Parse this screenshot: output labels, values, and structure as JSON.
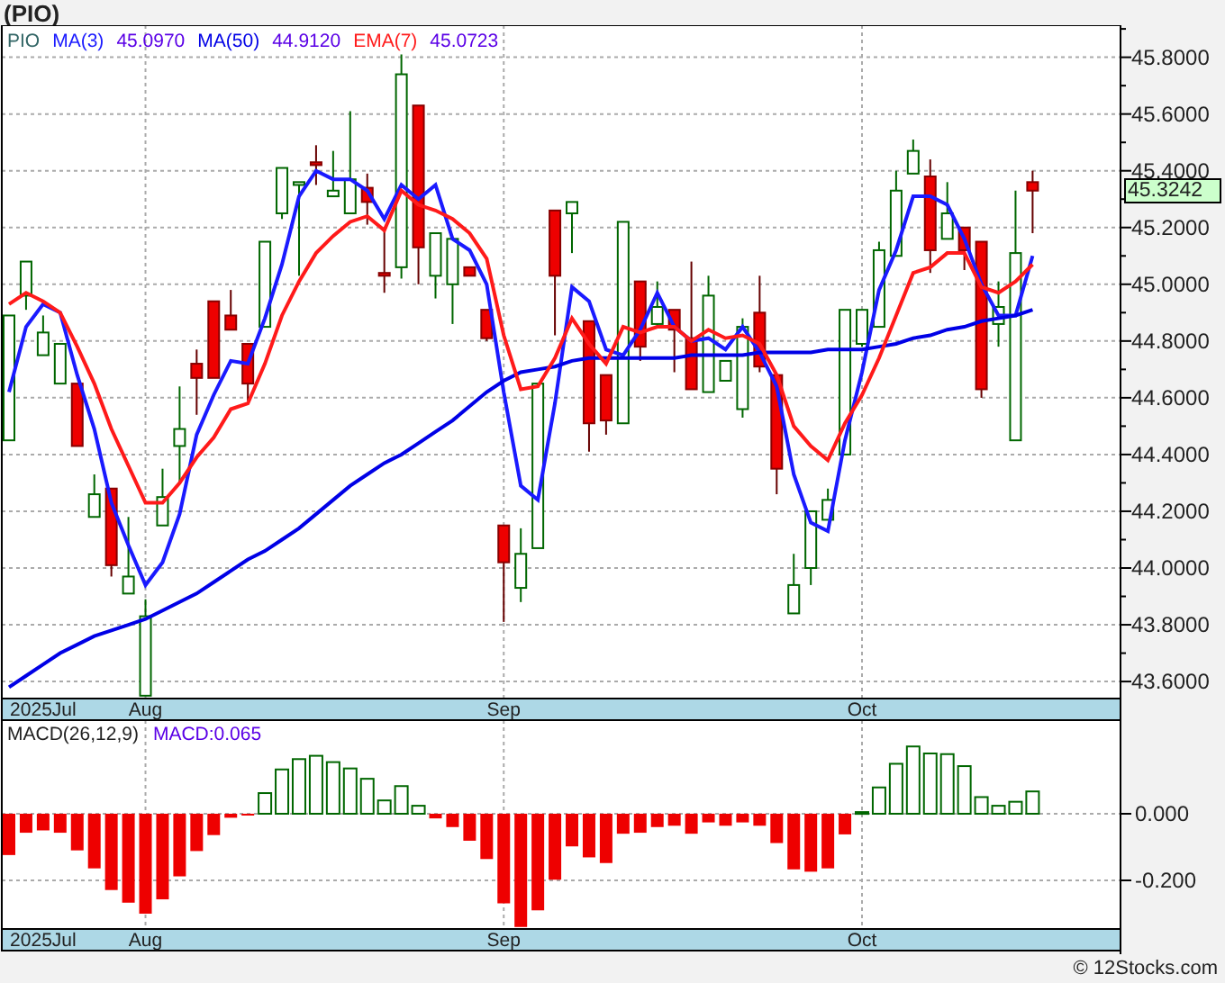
{
  "title": "(PIO)",
  "price_chart": {
    "ticker": "PIO",
    "legend_values": [
      "45.0970",
      "44.9120",
      "45.0723"
    ],
    "last_price": "45.3242",
    "chart_data": {
      "type": "candlestick",
      "ylim": [
        43.54,
        45.913
      ],
      "grid": true,
      "categories": [
        null,
        null,
        "2025Jul",
        null,
        null,
        null,
        null,
        null,
        "Aug",
        null,
        null,
        null,
        null,
        null,
        null,
        null,
        null,
        null,
        null,
        null,
        null,
        null,
        null,
        null,
        null,
        null,
        null,
        null,
        null,
        "Sep",
        null,
        null,
        null,
        null,
        null,
        null,
        null,
        null,
        null,
        null,
        null,
        null,
        null,
        null,
        null,
        null,
        null,
        null,
        null,
        null,
        "Oct",
        null,
        null,
        null,
        null,
        null,
        null,
        null,
        null,
        null,
        null
      ],
      "yticks": [
        {
          "value": 43.6,
          "label": "43.6000"
        },
        {
          "value": 43.8,
          "label": "43.8000"
        },
        {
          "value": 44.0,
          "label": "44.0000"
        },
        {
          "value": 44.2,
          "label": "44.2000"
        },
        {
          "value": 44.4,
          "label": "44.4000"
        },
        {
          "value": 44.6,
          "label": "44.6000"
        },
        {
          "value": 44.8,
          "label": "44.8000"
        },
        {
          "value": 45.0,
          "label": "45.0000"
        },
        {
          "value": 45.2,
          "label": "45.2000"
        },
        {
          "value": 45.4,
          "label": "45.4000"
        },
        {
          "value": 45.6,
          "label": "45.6000"
        },
        {
          "value": 45.8,
          "label": "45.8000"
        }
      ],
      "ohlc": [
        [
          44.45,
          44.89,
          44.45,
          44.89
        ],
        [
          44.96,
          45.08,
          44.91,
          45.08
        ],
        [
          44.75,
          44.89,
          44.75,
          44.83
        ],
        [
          44.65,
          44.79,
          44.65,
          44.79
        ],
        [
          44.65,
          44.65,
          44.43,
          44.43
        ],
        [
          44.18,
          44.33,
          44.18,
          44.26
        ],
        [
          44.28,
          44.28,
          43.97,
          44.01
        ],
        [
          43.91,
          44.18,
          43.91,
          43.97
        ],
        [
          43.55,
          43.89,
          43.55,
          43.83
        ],
        [
          44.15,
          44.35,
          44.15,
          44.25
        ],
        [
          44.43,
          44.64,
          44.3,
          44.49
        ],
        [
          44.72,
          44.77,
          44.54,
          44.67
        ],
        [
          44.94,
          44.94,
          44.67,
          44.67
        ],
        [
          44.89,
          44.98,
          44.84,
          44.84
        ],
        [
          44.79,
          44.79,
          44.59,
          44.65
        ],
        [
          44.85,
          45.15,
          44.85,
          45.15
        ],
        [
          45.25,
          45.41,
          45.23,
          45.41
        ],
        [
          45.35,
          45.36,
          45.03,
          45.36
        ],
        [
          45.43,
          45.49,
          45.35,
          45.42
        ],
        [
          45.31,
          45.47,
          45.31,
          45.33
        ],
        [
          45.25,
          45.61,
          45.25,
          45.37
        ],
        [
          45.34,
          45.39,
          45.21,
          45.29
        ],
        [
          45.04,
          45.19,
          44.97,
          45.03
        ],
        [
          45.06,
          45.81,
          45.02,
          45.74
        ],
        [
          45.63,
          45.63,
          45.0,
          45.13
        ],
        [
          45.03,
          45.18,
          44.95,
          45.18
        ],
        [
          45.0,
          45.16,
          44.86,
          45.16
        ],
        [
          45.06,
          45.06,
          45.03,
          45.03
        ],
        [
          44.91,
          44.91,
          44.8,
          44.81
        ],
        [
          44.15,
          44.15,
          43.81,
          44.02
        ],
        [
          43.93,
          44.14,
          43.88,
          44.05
        ],
        [
          44.07,
          44.65,
          44.07,
          44.65
        ],
        [
          45.26,
          45.26,
          44.82,
          45.03
        ],
        [
          45.25,
          45.29,
          45.11,
          45.29
        ],
        [
          44.87,
          44.87,
          44.41,
          44.51
        ],
        [
          44.68,
          44.68,
          44.47,
          44.52
        ],
        [
          44.51,
          45.22,
          44.51,
          45.22
        ],
        [
          45.01,
          45.01,
          44.73,
          44.78
        ],
        [
          44.86,
          45.01,
          44.85,
          44.92
        ],
        [
          44.91,
          44.91,
          44.69,
          44.84
        ],
        [
          44.81,
          45.08,
          44.63,
          44.63
        ],
        [
          44.62,
          45.03,
          44.62,
          44.96
        ],
        [
          44.66,
          44.73,
          44.66,
          44.73
        ],
        [
          44.56,
          44.88,
          44.53,
          44.85
        ],
        [
          44.9,
          45.03,
          44.69,
          44.71
        ],
        [
          44.68,
          44.68,
          44.26,
          44.35
        ],
        [
          43.84,
          44.05,
          43.84,
          43.94
        ],
        [
          44.0,
          44.2,
          43.94,
          44.2
        ],
        [
          44.17,
          44.28,
          44.17,
          44.24
        ],
        [
          44.4,
          44.91,
          44.4,
          44.91
        ],
        [
          44.79,
          44.91,
          44.78,
          44.91
        ],
        [
          44.85,
          45.15,
          44.85,
          45.12
        ],
        [
          45.1,
          45.4,
          45.1,
          45.33
        ],
        [
          45.39,
          45.51,
          45.39,
          45.47
        ],
        [
          45.38,
          45.44,
          45.04,
          45.12
        ],
        [
          45.16,
          45.36,
          45.16,
          45.25
        ],
        [
          45.2,
          45.2,
          45.05,
          45.12
        ],
        [
          45.15,
          45.15,
          44.6,
          44.63
        ],
        [
          44.86,
          45.01,
          44.78,
          44.92
        ],
        [
          44.45,
          45.33,
          44.45,
          45.11
        ],
        [
          45.36,
          45.4,
          45.18,
          45.33
        ]
      ],
      "series": [
        {
          "name": "MA(3)",
          "type": "line",
          "color": "#1a1aff",
          "values": [
            44.62,
            44.85,
            44.93,
            44.9,
            44.68,
            44.49,
            44.23,
            44.08,
            43.94,
            44.02,
            44.19,
            44.47,
            44.61,
            44.73,
            44.72,
            44.88,
            45.07,
            45.31,
            45.4,
            45.37,
            45.37,
            45.33,
            45.23,
            45.35,
            45.3,
            45.35,
            45.16,
            45.12,
            45.0,
            44.62,
            44.29,
            44.24,
            44.58,
            44.99,
            44.94,
            44.77,
            44.75,
            44.84,
            44.97,
            44.85,
            44.8,
            44.81,
            44.77,
            44.85,
            44.76,
            44.64,
            44.33,
            44.16,
            44.13,
            44.45,
            44.69,
            44.98,
            45.12,
            45.31,
            45.31,
            45.28,
            45.16,
            45.0,
            44.89,
            44.89,
            45.1
          ]
        },
        {
          "name": "MA(50)",
          "type": "line",
          "color": "#0000e6",
          "values": [
            43.58,
            43.62,
            43.66,
            43.7,
            43.73,
            43.76,
            43.78,
            43.8,
            43.82,
            43.85,
            43.88,
            43.91,
            43.95,
            43.99,
            44.03,
            44.06,
            44.1,
            44.14,
            44.19,
            44.24,
            44.29,
            44.33,
            44.37,
            44.4,
            44.44,
            44.48,
            44.52,
            44.57,
            44.62,
            44.66,
            44.69,
            44.7,
            44.71,
            44.73,
            44.74,
            44.74,
            44.74,
            44.74,
            44.74,
            44.74,
            44.75,
            44.75,
            44.75,
            44.75,
            44.76,
            44.76,
            44.76,
            44.76,
            44.77,
            44.77,
            44.77,
            44.78,
            44.79,
            44.81,
            44.82,
            44.84,
            44.85,
            44.87,
            44.88,
            44.89,
            44.91
          ]
        },
        {
          "name": "EMA(7)",
          "type": "line",
          "color": "#ff1a1a",
          "values": [
            44.93,
            44.97,
            44.94,
            44.9,
            44.78,
            44.65,
            44.49,
            44.36,
            44.23,
            44.23,
            44.3,
            44.39,
            44.46,
            44.56,
            44.58,
            44.72,
            44.89,
            45.01,
            45.11,
            45.17,
            45.22,
            45.24,
            45.19,
            45.33,
            45.28,
            45.26,
            45.23,
            45.18,
            45.09,
            44.82,
            44.63,
            44.64,
            44.74,
            44.88,
            44.79,
            44.72,
            44.85,
            44.83,
            44.85,
            44.85,
            44.8,
            44.84,
            44.81,
            44.82,
            44.79,
            44.68,
            44.5,
            44.43,
            44.38,
            44.51,
            44.61,
            44.74,
            44.89,
            45.04,
            45.06,
            45.11,
            45.11,
            44.99,
            44.97,
            45.01,
            45.07
          ]
        }
      ]
    }
  },
  "macd_chart": {
    "value": "MACD:0.065",
    "chart_data": {
      "type": "bar",
      "ylim": [
        -0.346,
        0.281
      ],
      "grid": true,
      "categories": [
        null,
        null,
        "2025Jul",
        null,
        null,
        null,
        null,
        null,
        "Aug",
        null,
        null,
        null,
        null,
        null,
        null,
        null,
        null,
        null,
        null,
        null,
        null,
        null,
        null,
        null,
        null,
        null,
        null,
        null,
        null,
        "Sep",
        null,
        null,
        null,
        null,
        null,
        null,
        null,
        null,
        null,
        null,
        null,
        null,
        null,
        null,
        null,
        null,
        null,
        null,
        null,
        null,
        "Oct",
        null,
        null,
        null,
        null,
        null,
        null,
        null,
        null,
        null,
        null
      ],
      "yticks": [
        {
          "value": 0,
          "label": "0.000"
        },
        {
          "value": -0.2,
          "label": "-0.200"
        }
      ],
      "series": [
        {
          "name": "MACD(26,12,9)",
          "values": [
            -0.124,
            -0.057,
            -0.05,
            -0.057,
            -0.11,
            -0.164,
            -0.229,
            -0.267,
            -0.3,
            -0.257,
            -0.188,
            -0.112,
            -0.064,
            -0.012,
            -0.005,
            0.062,
            0.133,
            0.164,
            0.174,
            0.155,
            0.136,
            0.105,
            0.04,
            0.083,
            0.024,
            -0.014,
            -0.04,
            -0.081,
            -0.136,
            -0.269,
            -0.34,
            -0.29,
            -0.198,
            -0.098,
            -0.131,
            -0.148,
            -0.06,
            -0.057,
            -0.04,
            -0.036,
            -0.06,
            -0.026,
            -0.036,
            -0.026,
            -0.036,
            -0.088,
            -0.167,
            -0.174,
            -0.164,
            -0.062,
            0.005,
            0.079,
            0.15,
            0.202,
            0.181,
            0.179,
            0.143,
            0.05,
            0.024,
            0.036,
            0.067
          ]
        }
      ]
    }
  },
  "footer": "© 12Stocks.com"
}
